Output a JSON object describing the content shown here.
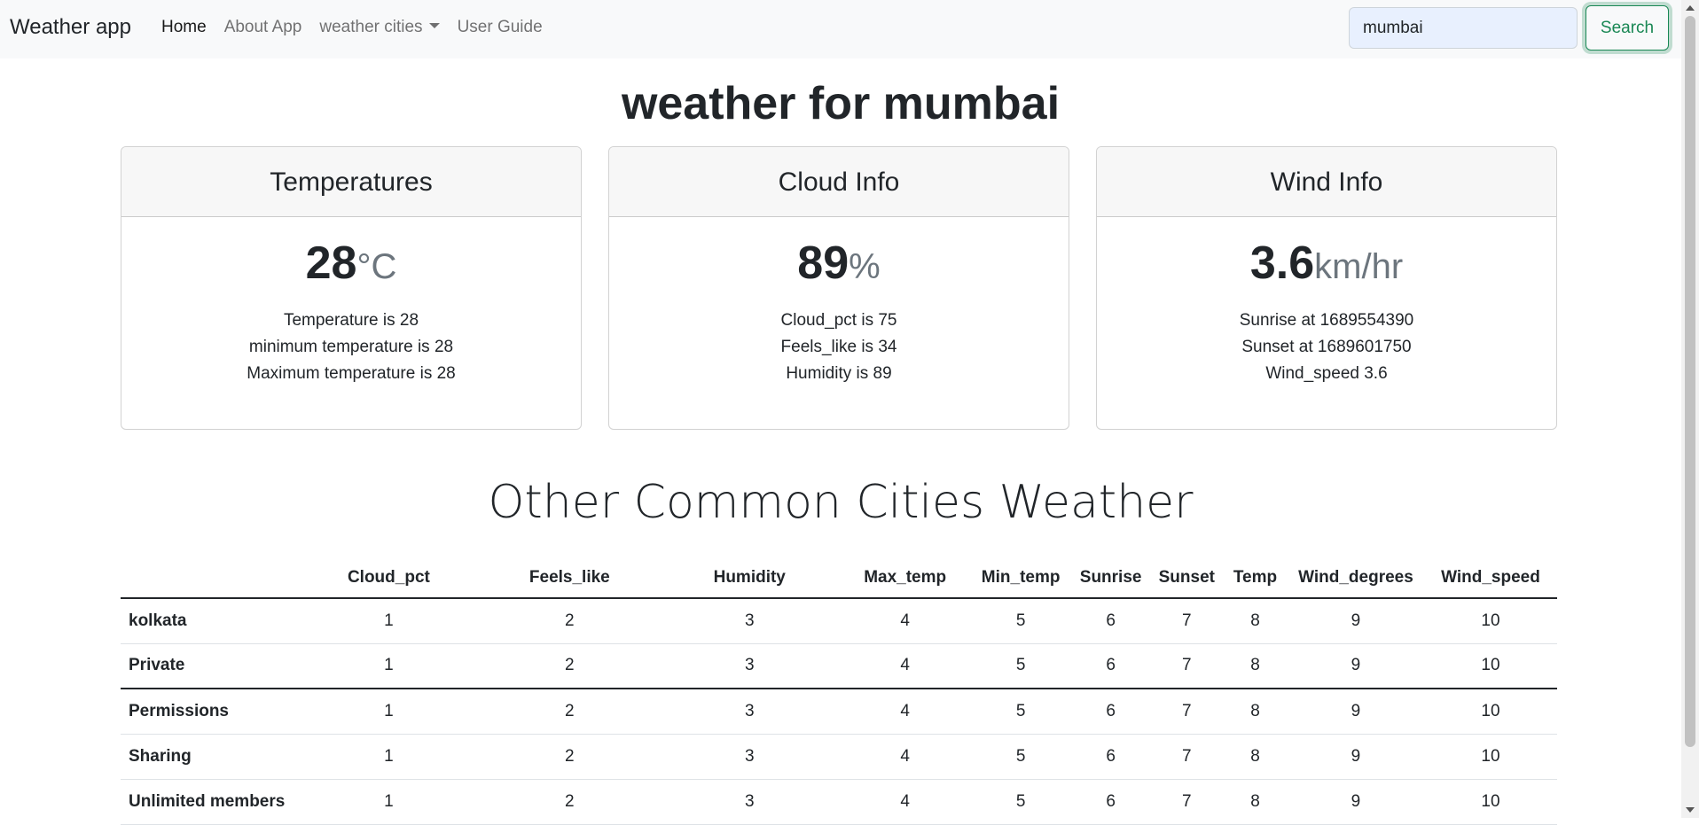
{
  "navbar": {
    "brand": "Weather app",
    "links": [
      {
        "label": "Home",
        "active": true
      },
      {
        "label": "About App",
        "active": false
      },
      {
        "label": "weather cities",
        "active": false,
        "dropdown": true
      },
      {
        "label": "User Guide",
        "active": false
      }
    ],
    "search_value": "mumbai",
    "search_button": "Search"
  },
  "title": "weather for mumbai",
  "cards": {
    "temperatures": {
      "header": "Temperatures",
      "value": "28",
      "unit": "°C",
      "lines": [
        "Temperature is 28",
        "minimum temperature is 28",
        "Maximum temperature is 28"
      ]
    },
    "cloud": {
      "header": "Cloud Info",
      "value": "89",
      "unit": "%",
      "lines": [
        "Cloud_pct is 75",
        "Feels_like is 34",
        "Humidity is 89"
      ]
    },
    "wind": {
      "header": "Wind Info",
      "value": "3.6",
      "unit": "km/hr",
      "lines": [
        "Sunrise at 1689554390",
        "Sunset at 1689601750",
        "Wind_speed 3.6"
      ]
    }
  },
  "section_title": "Other Common Cities Weather",
  "table": {
    "columns": [
      "",
      "Cloud_pct",
      "Feels_like",
      "Humidity",
      "Max_temp",
      "Min_temp",
      "Sunrise",
      "Sunset",
      "Temp",
      "Wind_degrees",
      "Wind_speed"
    ],
    "rows": [
      {
        "label": "kolkata",
        "values": [
          "1",
          "2",
          "3",
          "4",
          "5",
          "6",
          "7",
          "8",
          "9",
          "10"
        ]
      },
      {
        "label": "Private",
        "values": [
          "1",
          "2",
          "3",
          "4",
          "5",
          "6",
          "7",
          "8",
          "9",
          "10"
        ]
      },
      {
        "label": "Permissions",
        "values": [
          "1",
          "2",
          "3",
          "4",
          "5",
          "6",
          "7",
          "8",
          "9",
          "10"
        ]
      },
      {
        "label": "Sharing",
        "values": [
          "1",
          "2",
          "3",
          "4",
          "5",
          "6",
          "7",
          "8",
          "9",
          "10"
        ]
      },
      {
        "label": "Unlimited members",
        "values": [
          "1",
          "2",
          "3",
          "4",
          "5",
          "6",
          "7",
          "8",
          "9",
          "10"
        ]
      }
    ]
  },
  "colors": {
    "navbar_bg": "#f8f9fa",
    "search_input_bg": "#e8f0fe",
    "search_button": "#198754",
    "card_header_bg": "#f7f7f7",
    "unit_text": "#6c757d"
  }
}
